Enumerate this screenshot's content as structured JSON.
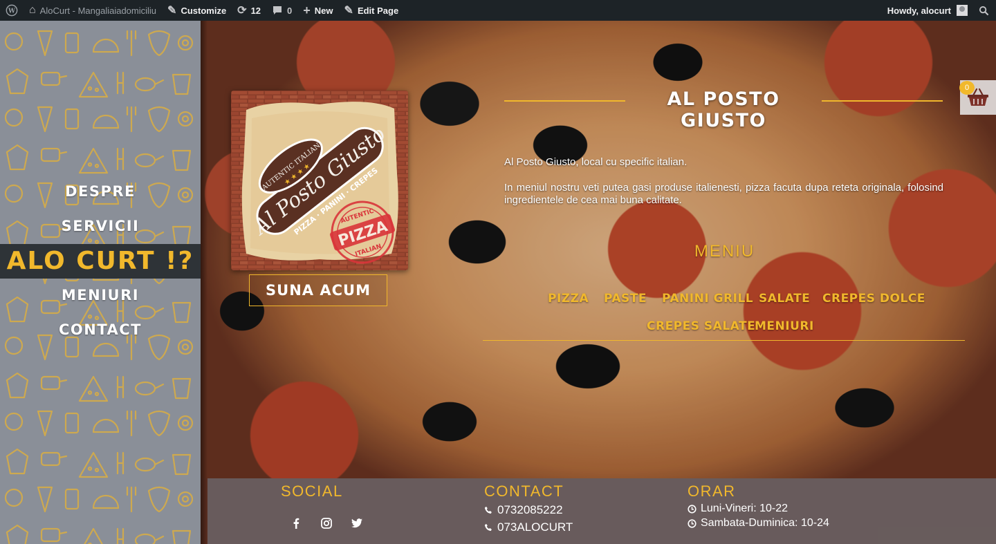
{
  "adminbar": {
    "site_name": "AloCurt - Mangaliaiadomiciliu",
    "customize": "Customize",
    "updates_count": "12",
    "comments_count": "0",
    "new_label": "New",
    "edit_page": "Edit Page",
    "howdy": "Howdy, alocurt"
  },
  "nav": {
    "items": [
      "DESPRE",
      "SERVICII",
      "ALO CURT !?",
      "MENIURI",
      "CONTACT"
    ],
    "active_index": 2
  },
  "hero": {
    "title": "AL POSTO GIUSTO",
    "description_1": "Al Posto Giusto, local cu specific italian.",
    "description_2": "In meniul nostru veti putea gasi produse italienesti, pizza facuta dupa reteta originala, folosind ingredientele de cea mai buna calitate.",
    "call_button": "SUNA ACUM",
    "logo": {
      "top_text": "AUTENTIC ITALIAN",
      "brand": "Al Posto Giusto",
      "tags": "PIZZA · PANINI · CREPES",
      "stamp_top": "AUTENTIC",
      "stamp_main": "PIZZA",
      "stamp_bottom": "ITALIAN"
    }
  },
  "menu": {
    "title": "MENIU",
    "items": [
      "PIZZA",
      "PASTE",
      "PANINI GRILL",
      "SALATE",
      "CREPES DOLCE",
      "CREPES SALATE",
      "MENIURI"
    ]
  },
  "cart": {
    "count": "0"
  },
  "footer": {
    "social_title": "SOCIAL",
    "social_icons": [
      "facebook-icon",
      "instagram-icon",
      "twitter-icon"
    ],
    "contact_title": "CONTACT",
    "phones": [
      "0732085222",
      "073ALOCURT"
    ],
    "hours_title": "ORAR",
    "hours": [
      "Luni-Vineri: 10-22",
      "Sambata-Duminica: 10-24"
    ]
  },
  "colors": {
    "accent": "#f1b82c",
    "adminbar": "#1d2327",
    "nav_active_bg": "#2e3337"
  }
}
